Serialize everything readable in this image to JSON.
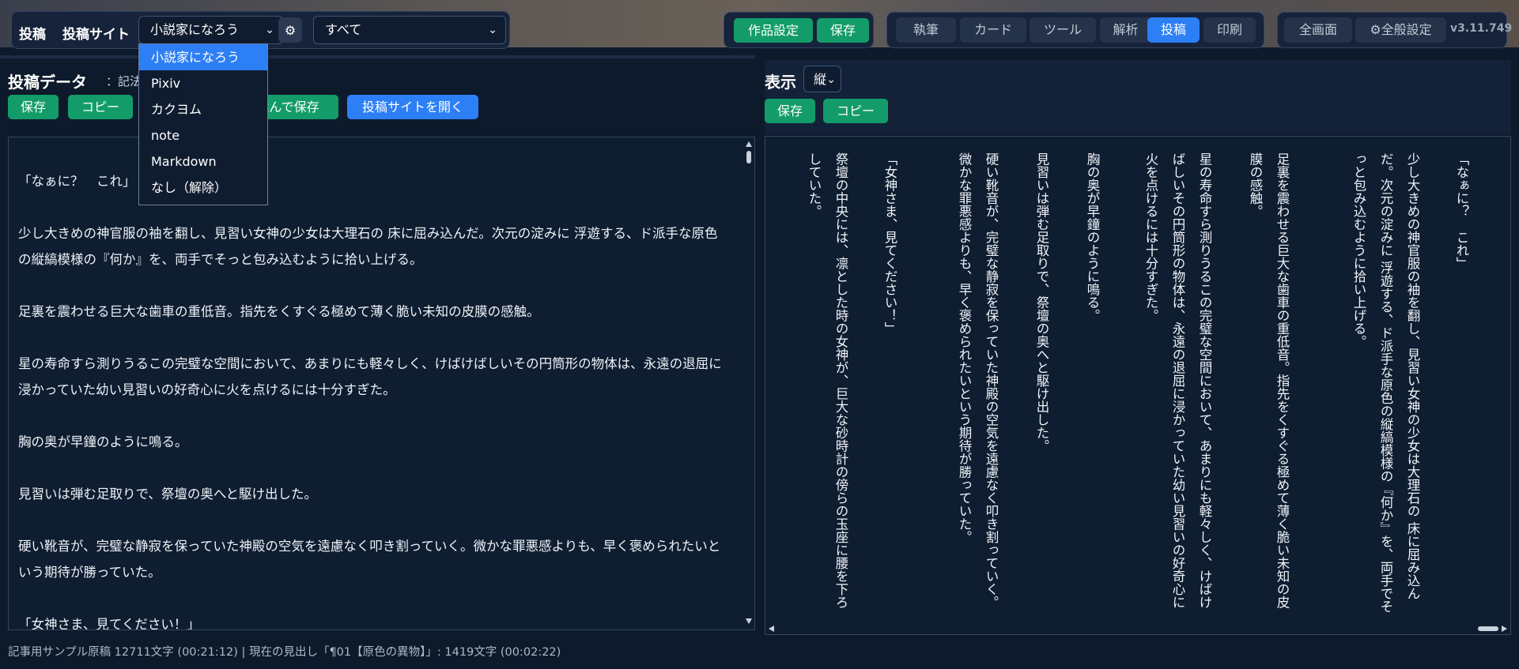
{
  "topbar": {
    "toukou_label": "投稿",
    "site_label": "投稿サイト",
    "site_select_value": "小説家になろう",
    "filter_select_value": "すべて",
    "sakuhin_settei": "作品設定",
    "save": "保存",
    "tabs": [
      "執筆",
      "カード",
      "ツール",
      "解析",
      "投稿",
      "印刷"
    ],
    "fullscreen": "全画面",
    "global_settings": "⚙全般設定",
    "version": "v3.11.749"
  },
  "dropdown": {
    "items": [
      "小説家になろう",
      "Pixiv",
      "カクヨム",
      "note",
      "Markdown",
      "なし（解除）"
    ]
  },
  "left": {
    "title": "投稿データ",
    "note": "：記法",
    "buttons": {
      "save": "保存",
      "copy": "コピー",
      "combined_save": "選んで保存",
      "open_site": "投稿サイトを開く"
    },
    "paragraphs": [
      "「なぁに？　これ」",
      "少し大きめの神官服の袖を翻し、見習い女神の少女は大理石の 床に屈み込んだ。次元の淀みに 浮遊する、ド派手な原色の縦縞模様の『何か』を、両手でそっと包み込むように拾い上げる。",
      "足裏を震わせる巨大な歯車の重低音。指先をくすぐる極めて薄く脆い未知の皮膜の感触。",
      "星の寿命すら測りうるこの完璧な空間において、あまりにも軽々しく、けばけばしいその円筒形の物体は、永遠の退屈に浸かっていた幼い見習いの好奇心に火を点けるには十分すぎた。",
      "胸の奥が早鐘のように鳴る。",
      "見習いは弾む足取りで、祭壇の奥へと駆け出した。",
      "硬い靴音が、完璧な静寂を保っていた神殿の空気を遠慮なく叩き割っていく。微かな罪悪感よりも、早く褒められたいという期待が勝っていた。",
      "「女神さま、見てください！」"
    ]
  },
  "right": {
    "title": "表示",
    "orientation": "縦",
    "buttons": {
      "save": "保存",
      "copy": "コピー"
    },
    "columns": [
      "「なぁに？　これ」",
      "少し大きめの神官服の袖を翻し、見習い女神の少女は大理石の 床に屈み込んだ。次元の淀みに 浮遊する、ド派手な原色の縦縞模様の『何か』を、両手でそっと包み込むように拾い上げる。",
      "足裏を震わせる巨大な歯車の重低音。指先をくすぐる極めて薄く脆い未知の皮膜の感触。",
      "星の寿命すら測りうるこの完璧な空間において、あまりにも軽々しく、けばけばしいその円筒形の物体は、永遠の退屈に浸かっていた幼い見習いの好奇心に火を点けるには十分すぎた。",
      "胸の奥が早鐘のように鳴る。",
      "見習いは弾む足取りで、祭壇の奥へと駆け出した。",
      "硬い靴音が、完璧な静寂を保っていた神殿の空気を遠慮なく叩き割っていく。微かな罪悪感よりも、早く褒められたいという期待が勝っていた。",
      "「女神さま、見てください！」",
      "祭壇の中央には、凛とした時の女神が、巨大な砂時計の傍らの玉座に腰を下ろしていた。"
    ]
  },
  "status": "記事用サンプル原稿 12711文字 (00:21:12) | 現在の見出し「¶01【原色の異物】」: 1419文字 (00:02:22)"
}
